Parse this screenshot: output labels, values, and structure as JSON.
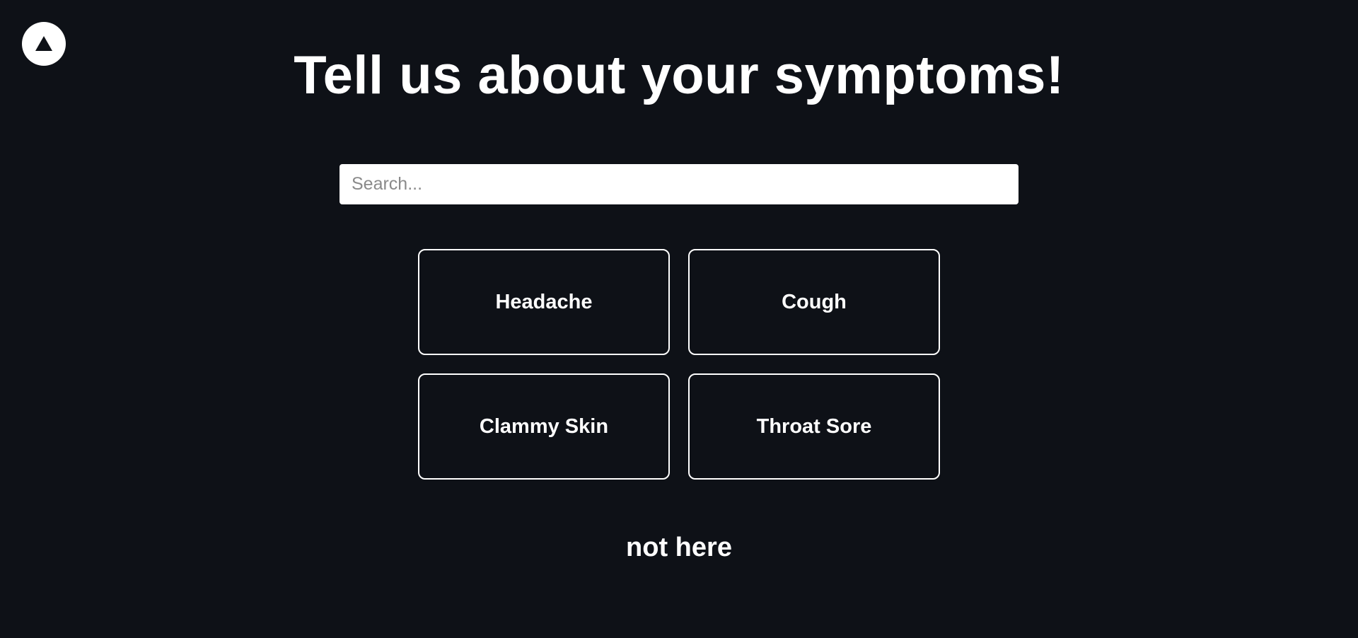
{
  "nav": {
    "top_button_icon": "triangle-up-icon"
  },
  "header": {
    "title": "Tell us about your symptoms!"
  },
  "search": {
    "placeholder": "Search...",
    "value": ""
  },
  "symptoms": [
    {
      "label": "Headache"
    },
    {
      "label": "Cough"
    },
    {
      "label": "Clammy Skin"
    },
    {
      "label": "Throat Sore"
    }
  ],
  "footer": {
    "not_here_label": "not here"
  },
  "colors": {
    "background": "#0e1117",
    "text": "#ffffff",
    "card_border": "#ffffff",
    "search_background": "#ffffff",
    "placeholder": "#8a8a8a"
  }
}
